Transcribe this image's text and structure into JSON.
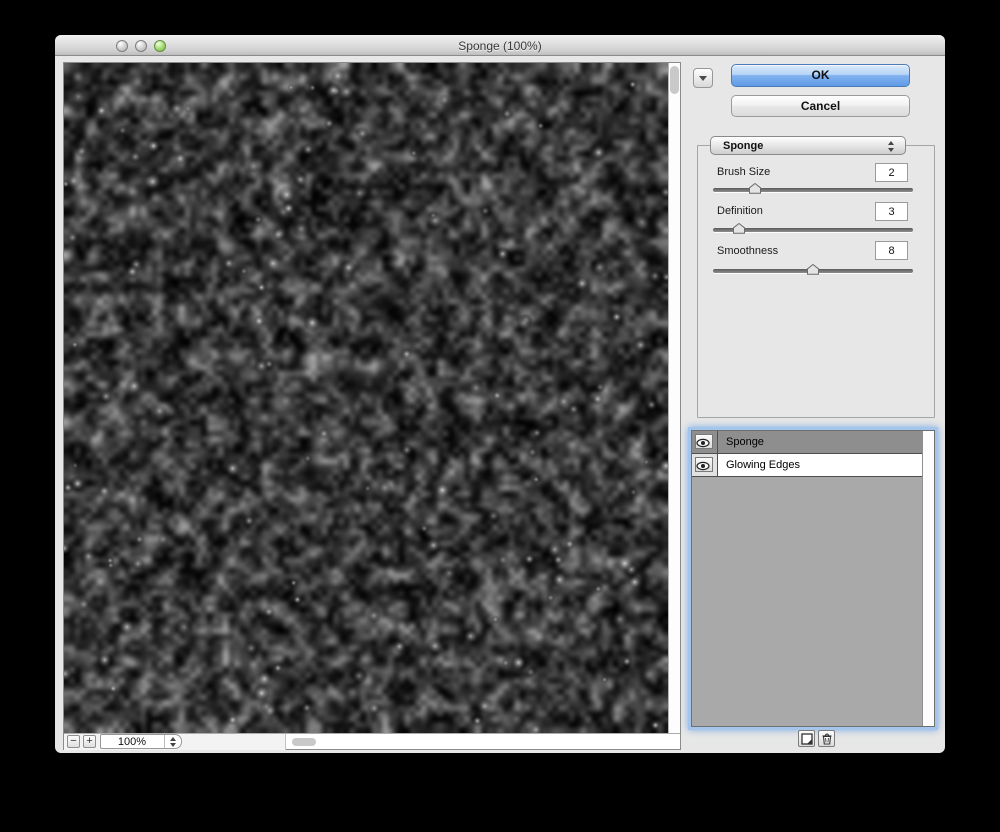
{
  "window": {
    "title": "Sponge (100%)"
  },
  "actions": {
    "ok_label": "OK",
    "cancel_label": "Cancel"
  },
  "filter_select": {
    "value": "Sponge"
  },
  "sliders": [
    {
      "label": "Brush Size",
      "value": "2",
      "pos": "21%"
    },
    {
      "label": "Definition",
      "value": "3",
      "pos": "13%"
    },
    {
      "label": "Smoothness",
      "value": "8",
      "pos": "50%"
    }
  ],
  "effect_layers": {
    "items": [
      {
        "name": "Sponge",
        "visible": true,
        "selected": true
      },
      {
        "name": "Glowing Edges",
        "visible": true,
        "selected": false
      }
    ]
  },
  "zoom_controls": {
    "level": "100%",
    "zoom_out_glyph": "−",
    "zoom_in_glyph": "+"
  },
  "icons": {
    "visibility": "eye-icon",
    "new_effect_layer": "new-layer-icon",
    "delete_effect_layer": "trash-icon",
    "filter_popup": "up-down-stepper-icon",
    "panel_disclosure": "chevron-down-icon"
  },
  "colors": {
    "ok_button_blue": "#5F9CE7",
    "focus_ring_blue": "#A5C6EC",
    "selected_row_gray": "#8E8E8E",
    "window_gray": "#E7E7E7"
  },
  "preview": {
    "description": "dark grayscale sponge texture at 100% zoom"
  }
}
